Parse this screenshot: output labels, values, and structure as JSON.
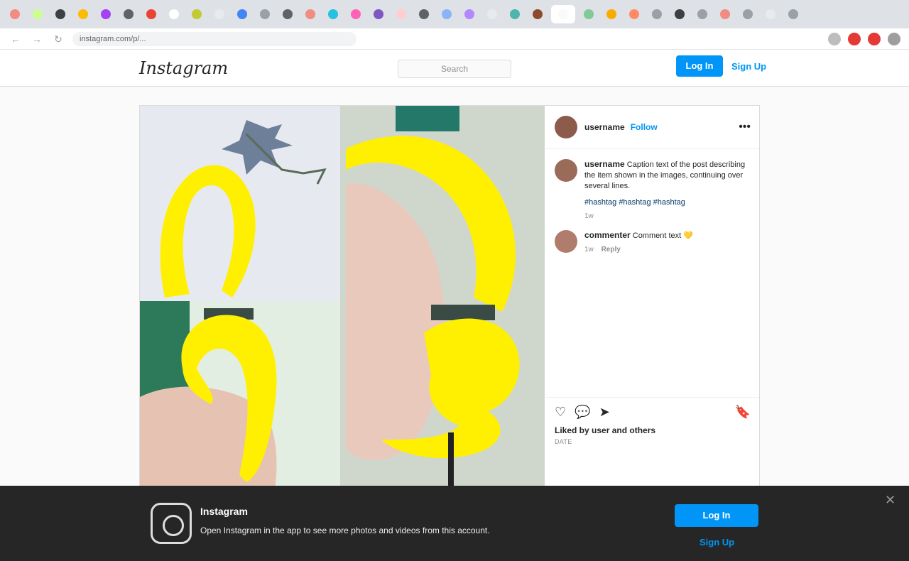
{
  "browser": {
    "tabs": [
      {
        "color": "#f28b82"
      },
      {
        "color": "#ccff90"
      },
      {
        "color": "#3c4043"
      },
      {
        "color": "#fbbc04"
      },
      {
        "color": "#a142f4"
      },
      {
        "color": "#5f6368"
      },
      {
        "color": "#ea4335"
      },
      {
        "color": "#ffffff"
      },
      {
        "color": "#c0ca33"
      },
      {
        "color": "#e8eaed"
      },
      {
        "color": "#4285f4"
      },
      {
        "color": "#9aa0a6"
      },
      {
        "color": "#5f6368"
      },
      {
        "color": "#f28b82"
      },
      {
        "color": "#24c1e0"
      },
      {
        "color": "#ff63b8"
      },
      {
        "color": "#7e57c2"
      },
      {
        "color": "#ffcdd2"
      },
      {
        "color": "#5f6368"
      },
      {
        "color": "#8ab4f8"
      },
      {
        "color": "#b388ff"
      },
      {
        "color": "#e8eaed"
      },
      {
        "color": "#4db6ac"
      },
      {
        "color": "#8d4b2c"
      }
    ],
    "active_tab": 24,
    "tabs_right": [
      {
        "color": "#81c995"
      },
      {
        "color": "#f9ab00"
      },
      {
        "color": "#ff8a65"
      },
      {
        "color": "#9aa0a6"
      },
      {
        "color": "#3c4043"
      },
      {
        "color": "#9aa0a6"
      },
      {
        "color": "#f28b82"
      },
      {
        "color": "#9aa0a6"
      },
      {
        "color": "#e8eaed"
      },
      {
        "color": "#9aa0a6"
      }
    ],
    "nav": {
      "back": "←",
      "forward": "→",
      "reload": "↻"
    },
    "url": "instagram.com/p/...",
    "extensions": [
      {
        "color": "#bdbdbd"
      },
      {
        "color": "#e53935"
      },
      {
        "color": "#e53935"
      },
      {
        "color": "#9e9e9e"
      }
    ]
  },
  "instagram": {
    "logo": "Instagram",
    "search_placeholder": "Search",
    "login": "Log In",
    "signup": "Sign Up"
  },
  "post": {
    "author": {
      "name": "username",
      "follow": "Follow",
      "avatar_color": "#8d5b4c",
      "more": "•••"
    },
    "caption": {
      "author": "username",
      "avatar_color": "#9b6b5a",
      "text": "Caption text of the post describing the item shown in the images, continuing over several lines.",
      "link": "#hashtag #hashtag #hashtag",
      "time": "1w"
    },
    "comment": {
      "author": "commenter",
      "avatar_color": "#b07c6b",
      "text": "Comment text 💛",
      "time": "1w",
      "reply": "Reply"
    },
    "actions": {
      "like": "♡",
      "comment": "💬",
      "share": "➤",
      "save": "🔖"
    },
    "likes": "Liked by user and others",
    "date": "DATE"
  },
  "banner": {
    "title": "Instagram",
    "text": "Open Instagram in the app to see more photos and videos from this account.",
    "login": "Log In",
    "signup": "Sign Up",
    "close": "✕"
  }
}
